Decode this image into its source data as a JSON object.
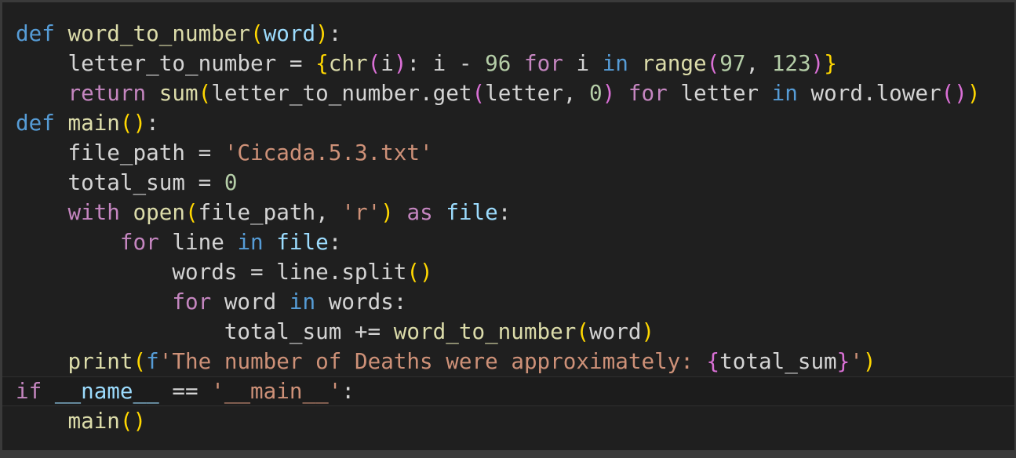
{
  "editor": {
    "language": "python",
    "theme": {
      "background": "#1f1f1f",
      "keyword": "#569cd6",
      "function": "#dcdcaa",
      "parameter": "#9cdcfe",
      "control": "#c586c0",
      "string": "#ce9178",
      "number": "#b5cea8",
      "bracket_level_1": "#ffd700",
      "bracket_level_2": "#da70d6"
    },
    "lines": [
      [
        {
          "t": "def",
          "c": "kw"
        },
        {
          "t": " ",
          "c": "df"
        },
        {
          "t": "word_to_number",
          "c": "fn"
        },
        {
          "t": "(",
          "c": "b1"
        },
        {
          "t": "word",
          "c": "pm"
        },
        {
          "t": ")",
          "c": "b1"
        },
        {
          "t": ":",
          "c": "df"
        }
      ],
      [
        {
          "t": "    letter_to_number = ",
          "c": "df"
        },
        {
          "t": "{",
          "c": "b1"
        },
        {
          "t": "chr",
          "c": "fn"
        },
        {
          "t": "(",
          "c": "b2"
        },
        {
          "t": "i",
          "c": "df"
        },
        {
          "t": ")",
          "c": "b2"
        },
        {
          "t": ": i - ",
          "c": "df"
        },
        {
          "t": "96",
          "c": "num"
        },
        {
          "t": " ",
          "c": "df"
        },
        {
          "t": "for",
          "c": "ctl"
        },
        {
          "t": " i ",
          "c": "df"
        },
        {
          "t": "in",
          "c": "kw"
        },
        {
          "t": " ",
          "c": "df"
        },
        {
          "t": "range",
          "c": "fn"
        },
        {
          "t": "(",
          "c": "b2"
        },
        {
          "t": "97",
          "c": "num"
        },
        {
          "t": ", ",
          "c": "df"
        },
        {
          "t": "123",
          "c": "num"
        },
        {
          "t": ")",
          "c": "b2"
        },
        {
          "t": "}",
          "c": "b1"
        }
      ],
      [
        {
          "t": "    ",
          "c": "df"
        },
        {
          "t": "return",
          "c": "ctl"
        },
        {
          "t": " ",
          "c": "df"
        },
        {
          "t": "sum",
          "c": "fn"
        },
        {
          "t": "(",
          "c": "b1"
        },
        {
          "t": "letter_to_number.get",
          "c": "df"
        },
        {
          "t": "(",
          "c": "b2"
        },
        {
          "t": "letter, ",
          "c": "df"
        },
        {
          "t": "0",
          "c": "num"
        },
        {
          "t": ")",
          "c": "b2"
        },
        {
          "t": " ",
          "c": "df"
        },
        {
          "t": "for",
          "c": "ctl"
        },
        {
          "t": " letter ",
          "c": "df"
        },
        {
          "t": "in",
          "c": "kw"
        },
        {
          "t": " word.lower",
          "c": "df"
        },
        {
          "t": "()",
          "c": "b2"
        },
        {
          "t": ")",
          "c": "b1"
        }
      ],
      [
        {
          "t": "def",
          "c": "kw"
        },
        {
          "t": " ",
          "c": "df"
        },
        {
          "t": "main",
          "c": "fn"
        },
        {
          "t": "()",
          "c": "b1"
        },
        {
          "t": ":",
          "c": "df"
        }
      ],
      [
        {
          "t": "    file_path = ",
          "c": "df"
        },
        {
          "t": "'Cicada.5.3.txt'",
          "c": "str"
        }
      ],
      [
        {
          "t": "    total_sum = ",
          "c": "df"
        },
        {
          "t": "0",
          "c": "num"
        }
      ],
      [
        {
          "t": "    ",
          "c": "df"
        },
        {
          "t": "with",
          "c": "ctl"
        },
        {
          "t": " ",
          "c": "df"
        },
        {
          "t": "open",
          "c": "fn"
        },
        {
          "t": "(",
          "c": "b1"
        },
        {
          "t": "file_path, ",
          "c": "df"
        },
        {
          "t": "'r'",
          "c": "str"
        },
        {
          "t": ")",
          "c": "b1"
        },
        {
          "t": " ",
          "c": "df"
        },
        {
          "t": "as",
          "c": "ctl"
        },
        {
          "t": " ",
          "c": "df"
        },
        {
          "t": "file",
          "c": "pm"
        },
        {
          "t": ":",
          "c": "df"
        }
      ],
      [
        {
          "t": "        ",
          "c": "df"
        },
        {
          "t": "for",
          "c": "ctl"
        },
        {
          "t": " line ",
          "c": "df"
        },
        {
          "t": "in",
          "c": "kw"
        },
        {
          "t": " ",
          "c": "df"
        },
        {
          "t": "file",
          "c": "pm"
        },
        {
          "t": ":",
          "c": "df"
        }
      ],
      [
        {
          "t": "            words = line.split",
          "c": "df"
        },
        {
          "t": "()",
          "c": "b1"
        }
      ],
      [
        {
          "t": "            ",
          "c": "df"
        },
        {
          "t": "for",
          "c": "ctl"
        },
        {
          "t": " word ",
          "c": "df"
        },
        {
          "t": "in",
          "c": "kw"
        },
        {
          "t": " words:",
          "c": "df"
        }
      ],
      [
        {
          "t": "                total_sum += ",
          "c": "df"
        },
        {
          "t": "word_to_number",
          "c": "fn"
        },
        {
          "t": "(",
          "c": "b1"
        },
        {
          "t": "word",
          "c": "df"
        },
        {
          "t": ")",
          "c": "b1"
        }
      ],
      [
        {
          "t": "    ",
          "c": "df"
        },
        {
          "t": "print",
          "c": "fn"
        },
        {
          "t": "(",
          "c": "b1"
        },
        {
          "t": "f",
          "c": "kw"
        },
        {
          "t": "'The number of Deaths were approximately: ",
          "c": "str"
        },
        {
          "t": "{",
          "c": "b2"
        },
        {
          "t": "total_sum",
          "c": "df"
        },
        {
          "t": "}",
          "c": "b2"
        },
        {
          "t": "'",
          "c": "str"
        },
        {
          "t": ")",
          "c": "b1"
        }
      ],
      [
        {
          "t": "if",
          "c": "ctl"
        },
        {
          "t": " ",
          "c": "df"
        },
        {
          "t": "__name__",
          "c": "pm"
        },
        {
          "t": " == ",
          "c": "df"
        },
        {
          "t": "'__main__'",
          "c": "str"
        },
        {
          "t": ":",
          "c": "df"
        }
      ],
      [
        {
          "t": "    ",
          "c": "df"
        },
        {
          "t": "main",
          "c": "fn"
        },
        {
          "t": "()",
          "c": "b1"
        }
      ]
    ]
  }
}
